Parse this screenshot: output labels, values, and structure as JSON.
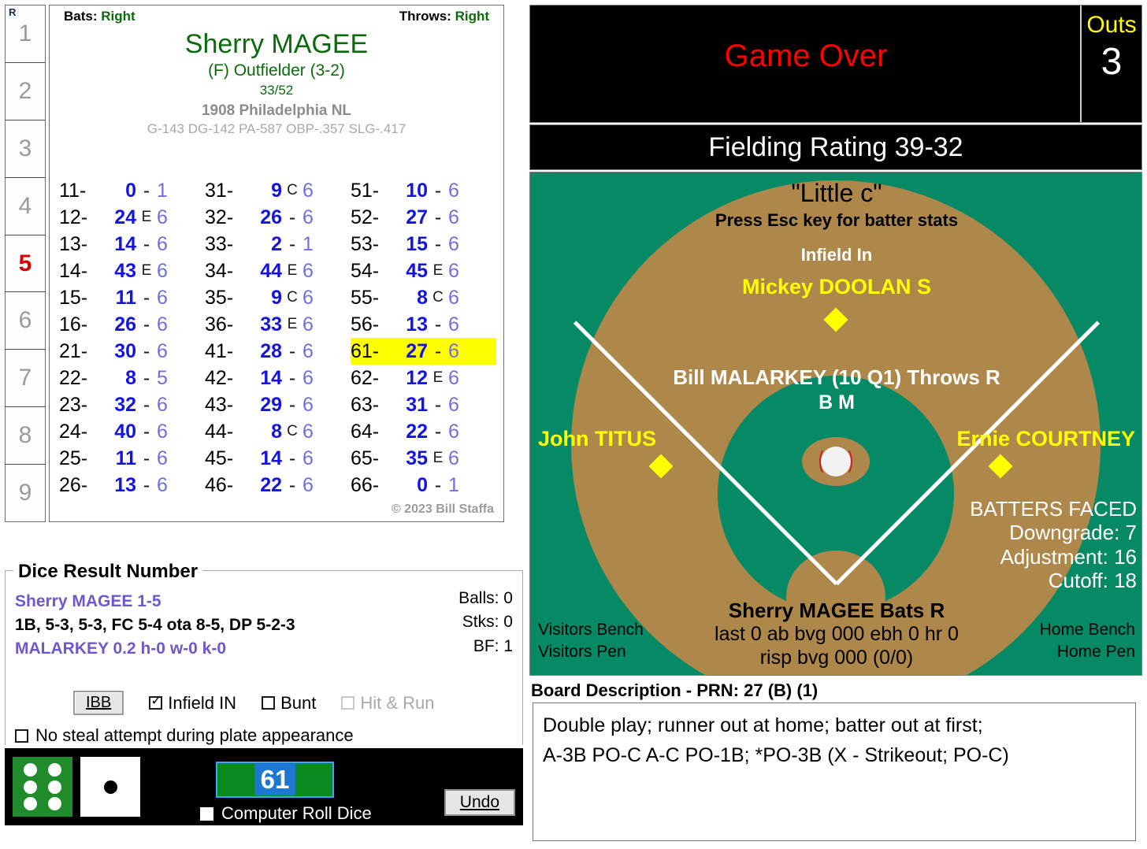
{
  "innings": {
    "header": "R",
    "cells": [
      "1",
      "2",
      "3",
      "4",
      "5",
      "6",
      "7",
      "8",
      "9"
    ],
    "current": "5"
  },
  "player_card": {
    "bats_label": "Bats:",
    "bats_value": "Right",
    "throws_label": "Throws:",
    "throws_value": "Right",
    "name": "Sherry MAGEE",
    "position": "(F) Outfielder (3-2)",
    "card_number": "33/52",
    "team": "1908 Philadelphia NL",
    "stats": "G-143 DG-142 PA-587 OBP-.357 SLG-.417",
    "copyright": "© 2023 Bill Staffa"
  },
  "dice_table": {
    "highlight_key": "61-",
    "columns": [
      [
        {
          "key": "11-",
          "val": "0",
          "mark": "-",
          "tail": "1"
        },
        {
          "key": "12-",
          "val": "24",
          "mark": "E",
          "tail": "6"
        },
        {
          "key": "13-",
          "val": "14",
          "mark": "-",
          "tail": "6"
        },
        {
          "key": "14-",
          "val": "43",
          "mark": "E",
          "tail": "6"
        },
        {
          "key": "15-",
          "val": "11",
          "mark": "-",
          "tail": "6"
        },
        {
          "key": "16-",
          "val": "26",
          "mark": "-",
          "tail": "6"
        },
        {
          "key": "21-",
          "val": "30",
          "mark": "-",
          "tail": "6"
        },
        {
          "key": "22-",
          "val": "8",
          "mark": "-",
          "tail": "5"
        },
        {
          "key": "23-",
          "val": "32",
          "mark": "-",
          "tail": "6"
        },
        {
          "key": "24-",
          "val": "40",
          "mark": "-",
          "tail": "6"
        },
        {
          "key": "25-",
          "val": "11",
          "mark": "-",
          "tail": "6"
        },
        {
          "key": "26-",
          "val": "13",
          "mark": "-",
          "tail": "6"
        }
      ],
      [
        {
          "key": "31-",
          "val": "9",
          "mark": "C",
          "tail": "6"
        },
        {
          "key": "32-",
          "val": "26",
          "mark": "-",
          "tail": "6"
        },
        {
          "key": "33-",
          "val": "2",
          "mark": "-",
          "tail": "1"
        },
        {
          "key": "34-",
          "val": "44",
          "mark": "E",
          "tail": "6"
        },
        {
          "key": "35-",
          "val": "9",
          "mark": "C",
          "tail": "6"
        },
        {
          "key": "36-",
          "val": "33",
          "mark": "E",
          "tail": "6"
        },
        {
          "key": "41-",
          "val": "28",
          "mark": "-",
          "tail": "6"
        },
        {
          "key": "42-",
          "val": "14",
          "mark": "-",
          "tail": "6"
        },
        {
          "key": "43-",
          "val": "29",
          "mark": "-",
          "tail": "6"
        },
        {
          "key": "44-",
          "val": "8",
          "mark": "C",
          "tail": "6"
        },
        {
          "key": "45-",
          "val": "14",
          "mark": "-",
          "tail": "6"
        },
        {
          "key": "46-",
          "val": "22",
          "mark": "-",
          "tail": "6"
        }
      ],
      [
        {
          "key": "51-",
          "val": "10",
          "mark": "-",
          "tail": "6"
        },
        {
          "key": "52-",
          "val": "27",
          "mark": "-",
          "tail": "6"
        },
        {
          "key": "53-",
          "val": "15",
          "mark": "-",
          "tail": "6"
        },
        {
          "key": "54-",
          "val": "45",
          "mark": "E",
          "tail": "6"
        },
        {
          "key": "55-",
          "val": "8",
          "mark": "C",
          "tail": "6"
        },
        {
          "key": "56-",
          "val": "13",
          "mark": "-",
          "tail": "6"
        },
        {
          "key": "61-",
          "val": "27",
          "mark": "-",
          "tail": "6"
        },
        {
          "key": "62-",
          "val": "12",
          "mark": "E",
          "tail": "6"
        },
        {
          "key": "63-",
          "val": "31",
          "mark": "-",
          "tail": "6"
        },
        {
          "key": "64-",
          "val": "22",
          "mark": "-",
          "tail": "6"
        },
        {
          "key": "65-",
          "val": "35",
          "mark": "E",
          "tail": "6"
        },
        {
          "key": "66-",
          "val": "0",
          "mark": "-",
          "tail": "1"
        }
      ]
    ]
  },
  "dice_result": {
    "title": "Dice Result Number",
    "batter_line": "Sherry MAGEE  1-5",
    "result_line": "1B, 5-3, 5-3, FC 5-4 ota 8-5, DP 5-2-3",
    "pitcher_line": "MALARKEY  0.2  h-0  w-0  k-0",
    "balls": "Balls: 0",
    "strikes": "Stks: 0",
    "bf": "BF: 1",
    "ibb_label": "IBB",
    "infield_in_label": "Infield IN",
    "infield_in_checked": true,
    "bunt_label": "Bunt",
    "bunt_checked": false,
    "hit_and_run_label": "Hit & Run",
    "hit_and_run_checked": false,
    "hit_and_run_disabled": true,
    "no_steal_label": "No steal attempt during plate appearance",
    "no_steal_checked": false
  },
  "dice_bar": {
    "green_die_value": 6,
    "white_die_value": 1,
    "roll_value": "61",
    "computer_roll_label": "Computer Roll Dice",
    "computer_roll_checked": false,
    "undo_label": "Undo"
  },
  "status": {
    "game_state": "Game Over",
    "outs_label": "Outs",
    "outs_value": "3",
    "fielding_rating": "Fielding Rating 39-32"
  },
  "field": {
    "ballpark_name": "\"Little c\"",
    "esc_hint": "Press Esc key for batter stats",
    "infield_in": "Infield In",
    "shortstop": "Mickey DOOLAN  S",
    "pitcher": "Bill MALARKEY (10 Q1) Throws R",
    "pitcher_tags": "B M",
    "third_baseman": "John TITUS",
    "first_baseman": "Ernie COURTNEY",
    "batters_faced_title": "BATTERS FACED",
    "downgrade": "Downgrade: 7",
    "adjustment": "Adjustment: 16",
    "cutoff": "Cutoff: 18",
    "batter": "Sherry MAGEE Bats R",
    "batter_line1": "last 0 ab bvg 000 ebh 0 hr 0",
    "batter_line2": "risp bvg 000 (0/0)",
    "visitors_bench": "Visitors Bench",
    "visitors_pen": "Visitors Pen",
    "home_bench": "Home Bench",
    "home_pen": "Home Pen"
  },
  "board_description": {
    "label": "Board Description - PRN: 27 (B) (1)",
    "line1": "Double play; runner out at home; batter out at first;",
    "line2": "A-3B PO-C A-C PO-1B; *PO-3B (X - Strikeout; PO-C)"
  },
  "colors": {
    "field_green": "#068A66",
    "dirt": "#AE874B",
    "highlight_yellow": "#FFFF00",
    "accent_blue": "#1414E0",
    "name_green": "#0A6B0A",
    "alert_red": "#FF0000"
  }
}
